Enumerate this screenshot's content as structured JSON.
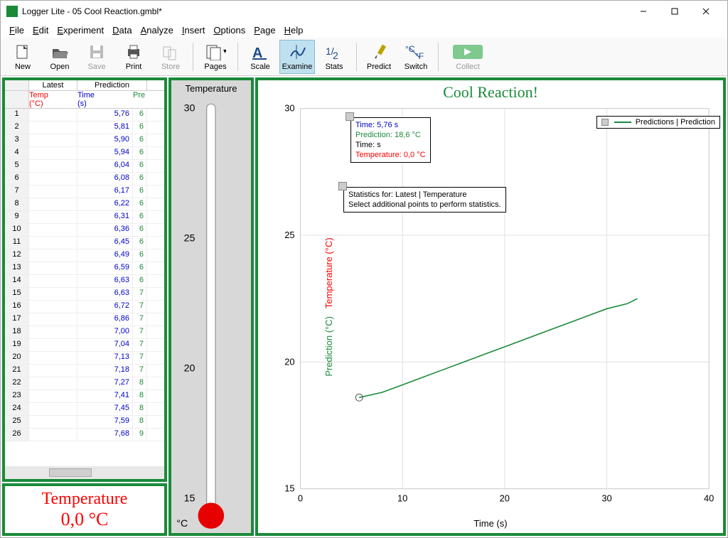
{
  "window": {
    "title": "Logger Lite - 05 Cool Reaction.gmbl*"
  },
  "menu": [
    "File",
    "Edit",
    "Experiment",
    "Data",
    "Analyze",
    "Insert",
    "Options",
    "Page",
    "Help"
  ],
  "toolbar": [
    {
      "label": "New",
      "icon": "new"
    },
    {
      "label": "Open",
      "icon": "open"
    },
    {
      "label": "Save",
      "icon": "save",
      "disabled": true
    },
    {
      "label": "Print",
      "icon": "print"
    },
    {
      "label": "Store",
      "icon": "store",
      "disabled": true
    },
    {
      "sep": true
    },
    {
      "label": "Pages",
      "icon": "pages"
    },
    {
      "sep": true
    },
    {
      "label": "Scale",
      "icon": "scale"
    },
    {
      "label": "Examine",
      "icon": "examine",
      "active": true
    },
    {
      "label": "Stats",
      "icon": "stats"
    },
    {
      "sep": true
    },
    {
      "label": "Predict",
      "icon": "predict"
    },
    {
      "label": "Switch",
      "icon": "switch"
    },
    {
      "sep": true
    },
    {
      "label": "Collect",
      "icon": "collect",
      "disabled": true,
      "wide": true
    }
  ],
  "table": {
    "group_headers": [
      "Latest",
      "Prediction"
    ],
    "headers": [
      {
        "label": "Temp",
        "unit": "(°C)",
        "color": "red"
      },
      {
        "label": "Time",
        "unit": "(s)",
        "color": "#0000cc"
      },
      {
        "label": "Pre",
        "unit": "",
        "color": "#1a8a3a"
      }
    ],
    "rows": [
      {
        "n": 1,
        "time": "5,76",
        "pred": "6"
      },
      {
        "n": 2,
        "time": "5,81",
        "pred": "6"
      },
      {
        "n": 3,
        "time": "5,90",
        "pred": "6"
      },
      {
        "n": 4,
        "time": "5,94",
        "pred": "6"
      },
      {
        "n": 5,
        "time": "6,04",
        "pred": "6"
      },
      {
        "n": 6,
        "time": "6,08",
        "pred": "6"
      },
      {
        "n": 7,
        "time": "6,17",
        "pred": "6"
      },
      {
        "n": 8,
        "time": "6,22",
        "pred": "6"
      },
      {
        "n": 9,
        "time": "6,31",
        "pred": "6"
      },
      {
        "n": 10,
        "time": "6,36",
        "pred": "6"
      },
      {
        "n": 11,
        "time": "6,45",
        "pred": "6"
      },
      {
        "n": 12,
        "time": "6,49",
        "pred": "6"
      },
      {
        "n": 13,
        "time": "6,59",
        "pred": "6"
      },
      {
        "n": 14,
        "time": "6,63",
        "pred": "6"
      },
      {
        "n": 15,
        "time": "6,63",
        "pred": "7"
      },
      {
        "n": 16,
        "time": "6,72",
        "pred": "7"
      },
      {
        "n": 17,
        "time": "6,86",
        "pred": "7"
      },
      {
        "n": 18,
        "time": "7,00",
        "pred": "7"
      },
      {
        "n": 19,
        "time": "7,04",
        "pred": "7"
      },
      {
        "n": 20,
        "time": "7,13",
        "pred": "7"
      },
      {
        "n": 21,
        "time": "7,18",
        "pred": "7"
      },
      {
        "n": 22,
        "time": "7,27",
        "pred": "8"
      },
      {
        "n": 23,
        "time": "7,41",
        "pred": "8"
      },
      {
        "n": 24,
        "time": "7,45",
        "pred": "8"
      },
      {
        "n": 25,
        "time": "7,59",
        "pred": "8"
      },
      {
        "n": 26,
        "time": "7,68",
        "pred": "9"
      }
    ]
  },
  "readout": {
    "label": "Temperature",
    "value": "0,0 °C"
  },
  "thermometer": {
    "label": "Temperature",
    "unit": "°C",
    "ticks": [
      "30",
      "25",
      "20",
      "15"
    ]
  },
  "chart": {
    "title": "Cool Reaction!",
    "xlabel": "Time (s)",
    "ylabel_pred": "Prediction (°C)",
    "ylabel_temp": "Temperature (°C)",
    "legend": "Predictions | Prediction",
    "info_time": "Time: 5,76 s",
    "info_pred": "Prediction: 18,6 °C",
    "info_time2": "Time:  s",
    "info_temp": "Temperature: 0,0 °C",
    "stats1": "Statistics for: Latest | Temperature",
    "stats2": "Select additional points to perform statistics.",
    "xticks": [
      "0",
      "10",
      "20",
      "30",
      "40"
    ],
    "yticks": [
      "30",
      "25",
      "20",
      "15"
    ]
  },
  "chart_data": {
    "type": "line",
    "title": "Cool Reaction!",
    "xlabel": "Time (s)",
    "ylabel": "Prediction (°C) / Temperature (°C)",
    "xlim": [
      0,
      40
    ],
    "ylim": [
      15,
      30
    ],
    "series": [
      {
        "name": "Predictions | Prediction",
        "color": "#1a8a3a",
        "x": [
          5.76,
          8,
          10,
          12,
          14,
          16,
          18,
          20,
          22,
          24,
          26,
          28,
          30,
          32,
          33
        ],
        "y": [
          18.6,
          18.8,
          19.1,
          19.4,
          19.7,
          20.0,
          20.3,
          20.6,
          20.9,
          21.2,
          21.5,
          21.8,
          22.1,
          22.3,
          22.5
        ]
      }
    ]
  }
}
